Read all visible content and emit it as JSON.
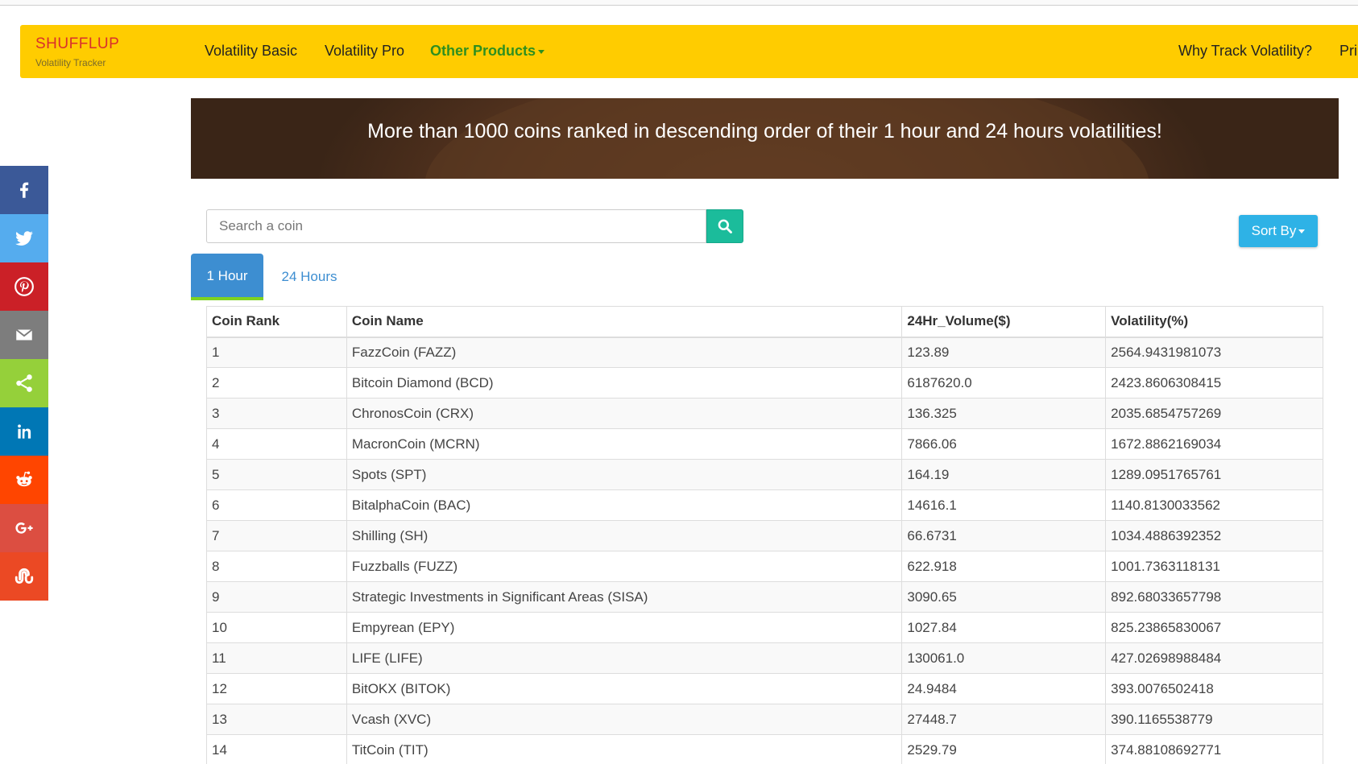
{
  "brand": {
    "logo": "SHUFFLUP",
    "tagline": "Volatility Tracker"
  },
  "nav": {
    "items": [
      {
        "label": "Volatility Basic"
      },
      {
        "label": "Volatility Pro"
      },
      {
        "label": "Other Products"
      },
      {
        "label": "Why Track Volatility?"
      },
      {
        "label": "Pri"
      }
    ]
  },
  "hero": {
    "text": "More than 1000 coins ranked in descending order of their 1 hour and 24 hours volatilities!"
  },
  "social": [
    "facebook-icon",
    "twitter-icon",
    "pinterest-icon",
    "email-icon",
    "share-icon",
    "linkedin-icon",
    "reddit-icon",
    "google-plus-icon",
    "stumbleupon-icon"
  ],
  "colors": {
    "navbar": "#ffcc00",
    "active_nav": "#2f8f1f",
    "search_button": "#1bbc9b",
    "sort_button": "#2eb2e6",
    "active_tab": "#3d8ed1",
    "tab_underline": "#7ed321"
  },
  "search": {
    "placeholder": "Search a coin",
    "value": ""
  },
  "sort": {
    "label": "Sort By"
  },
  "tabs": [
    {
      "label": "1 Hour",
      "active": true
    },
    {
      "label": "24 Hours",
      "active": false
    }
  ],
  "table": {
    "headers": [
      "Coin Rank",
      "Coin Name",
      "24Hr_Volume($)",
      "Volatility(%)"
    ],
    "rows": [
      [
        "1",
        "FazzCoin (FAZZ)",
        "123.89",
        "2564.9431981073"
      ],
      [
        "2",
        "Bitcoin Diamond (BCD)",
        "6187620.0",
        "2423.8606308415"
      ],
      [
        "3",
        "ChronosCoin (CRX)",
        "136.325",
        "2035.6854757269"
      ],
      [
        "4",
        "MacronCoin (MCRN)",
        "7866.06",
        "1672.8862169034"
      ],
      [
        "5",
        "Spots (SPT)",
        "164.19",
        "1289.0951765761"
      ],
      [
        "6",
        "BitalphaCoin (BAC)",
        "14616.1",
        "1140.8130033562"
      ],
      [
        "7",
        "Shilling (SH)",
        "66.6731",
        "1034.4886392352"
      ],
      [
        "8",
        "Fuzzballs (FUZZ)",
        "622.918",
        "1001.7363118131"
      ],
      [
        "9",
        "Strategic Investments in Significant Areas (SISA)",
        "3090.65",
        "892.68033657798"
      ],
      [
        "10",
        "Empyrean (EPY)",
        "1027.84",
        "825.23865830067"
      ],
      [
        "11",
        "LIFE (LIFE)",
        "130061.0",
        "427.02698988484"
      ],
      [
        "12",
        "BitOKX (BITOK)",
        "24.9484",
        "393.0076502418"
      ],
      [
        "13",
        "Vcash (XVC)",
        "27448.7",
        "390.1165538779"
      ],
      [
        "14",
        "TitCoin (TIT)",
        "2529.79",
        "374.88108692771"
      ]
    ]
  }
}
